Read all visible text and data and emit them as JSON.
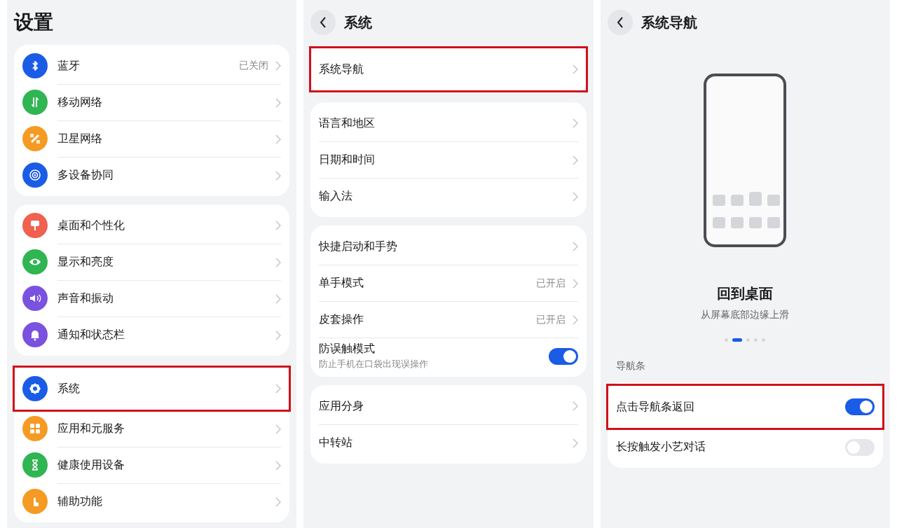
{
  "panels": [
    {
      "title": "设置",
      "back_button": false,
      "groups": [
        [
          {
            "kind": "link",
            "label": "蓝牙",
            "value": "已关闭",
            "color": "#1a5ce6",
            "highlighted": false
          },
          {
            "kind": "link",
            "label": "移动网络",
            "color": "#2fb552",
            "highlighted": false
          },
          {
            "kind": "link",
            "label": "卫星网络",
            "color": "#f59a23",
            "highlighted": false
          },
          {
            "kind": "link",
            "label": "多设备协同",
            "color": "#1a5ce6",
            "highlighted": false
          }
        ],
        [
          {
            "kind": "link",
            "label": "桌面和个性化",
            "color": "#f0614f",
            "highlighted": false
          },
          {
            "kind": "link",
            "label": "显示和亮度",
            "color": "#2fb552",
            "highlighted": false
          },
          {
            "kind": "link",
            "label": "声音和振动",
            "color": "#7a52e0",
            "highlighted": false
          },
          {
            "kind": "link",
            "label": "通知和状态栏",
            "color": "#7a52e0",
            "highlighted": false
          }
        ],
        [
          {
            "kind": "link",
            "label": "系统",
            "color": "#1a5ce6",
            "highlighted": true
          },
          {
            "kind": "link",
            "label": "应用和元服务",
            "color": "#f59a23",
            "highlighted": false
          },
          {
            "kind": "link",
            "label": "健康使用设备",
            "color": "#2fb552",
            "highlighted": false
          },
          {
            "kind": "link",
            "label": "辅助功能",
            "color": "#f59a23",
            "highlighted": false
          }
        ]
      ]
    },
    {
      "title": "系统",
      "back_button": true,
      "groups": [
        [
          {
            "kind": "link",
            "label": "系统导航",
            "highlighted": true
          }
        ],
        [
          {
            "kind": "link",
            "label": "语言和地区",
            "highlighted": false
          },
          {
            "kind": "link",
            "label": "日期和时间",
            "highlighted": false
          },
          {
            "kind": "link",
            "label": "输入法",
            "highlighted": false
          }
        ],
        [
          {
            "kind": "link",
            "label": "快捷启动和手势",
            "highlighted": false
          },
          {
            "kind": "link",
            "label": "单手模式",
            "value": "已开启",
            "highlighted": false
          },
          {
            "kind": "link",
            "label": "皮套操作",
            "value": "已开启",
            "highlighted": false
          },
          {
            "kind": "toggle",
            "label": "防误触模式",
            "subtitle": "防止手机在口袋出现误操作",
            "on": true,
            "highlighted": false
          }
        ],
        [
          {
            "kind": "link",
            "label": "应用分身",
            "highlighted": false
          },
          {
            "kind": "link",
            "label": "中转站",
            "highlighted": false
          }
        ]
      ]
    },
    {
      "title": "系统导航",
      "back_button": true,
      "preview": {
        "title": "回到桌面",
        "subtitle": "从屏幕底部边缘上滑",
        "pages": [
          {
            "selected": false
          },
          {
            "selected": true
          },
          {
            "selected": false
          },
          {
            "selected": false
          },
          {
            "selected": false
          }
        ]
      },
      "section_label": "导航条",
      "groups": [
        [
          {
            "kind": "toggle",
            "label": "点击导航条返回",
            "on": true,
            "highlighted": true
          },
          {
            "kind": "toggle",
            "label": "长按触发小艺对话",
            "on": false,
            "highlighted": false
          }
        ]
      ]
    }
  ]
}
